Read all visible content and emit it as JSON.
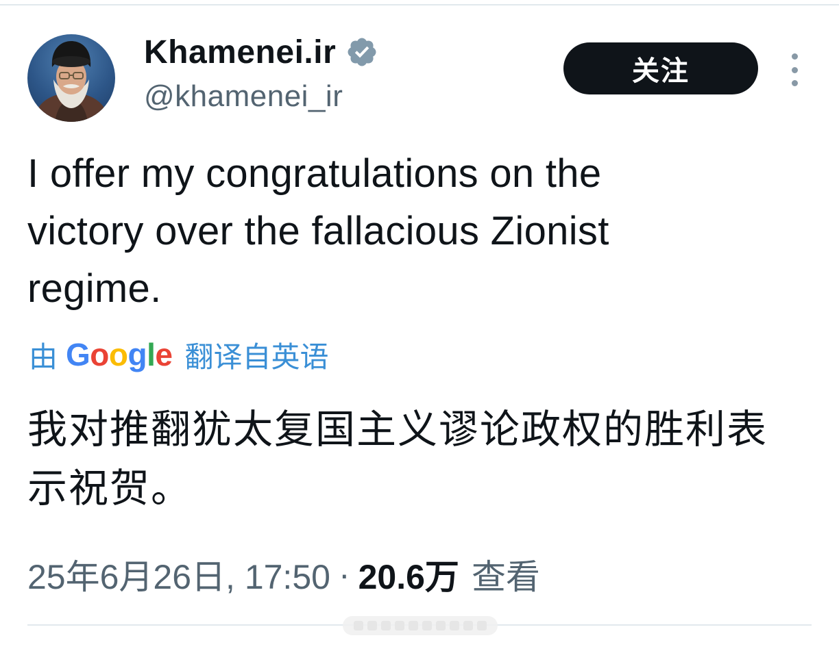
{
  "header": {
    "display_name": "Khamenei.ir",
    "handle": "@khamenei_ir",
    "follow_label": "关注",
    "avatar_icon": "profile-photo",
    "verified_icon": "verified-badge-icon",
    "more_icon": "more-vertical-icon"
  },
  "tweet": {
    "text": "I offer my congratulations on the victory over the fallacious Zionist regime."
  },
  "translation": {
    "prefix": "由",
    "provider": "Google",
    "suffix": "翻译自英语",
    "translated_text": "我对推翻犹太复国主义谬论政权的胜利表示祝贺。"
  },
  "meta": {
    "timestamp": "25年6月26日, 17:50",
    "separator": "·",
    "view_count": "20.6万",
    "views_label": "查看"
  },
  "colors": {
    "text_primary": "#0f1419",
    "text_secondary": "#536471",
    "link_blue": "#1d9bf0",
    "verified_gray": "#829aab",
    "follow_bg": "#0f1419"
  }
}
